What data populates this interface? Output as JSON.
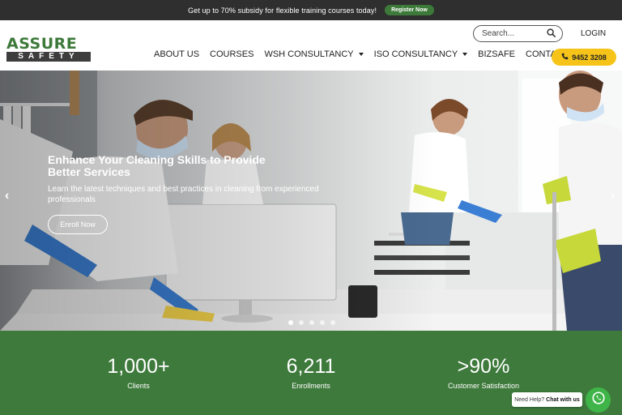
{
  "topbar": {
    "text": "Get up to 70% subsidy for flexible training courses today!",
    "button": "Register Now"
  },
  "logo": {
    "top": "ASSURE",
    "bottom": "SAFETY"
  },
  "search": {
    "placeholder": "Search..."
  },
  "header": {
    "login": "LOGIN",
    "phone": "9452 3208"
  },
  "nav": {
    "items": [
      {
        "label": "ABOUT US"
      },
      {
        "label": "COURSES"
      },
      {
        "label": "WSH CONSULTANCY"
      },
      {
        "label": "ISO CONSULTANCY"
      },
      {
        "label": "BIZSAFE"
      },
      {
        "label": "CONTACT US"
      }
    ]
  },
  "hero": {
    "title": "Enhance Your Cleaning Skills to Provide Better Services",
    "subtitle": "Learn the latest techniques and best practices in cleaning from experienced professionals",
    "button": "Enroll Now",
    "prev": "‹",
    "next": "›"
  },
  "stats": [
    {
      "value": "1,000+",
      "label": "Clients"
    },
    {
      "value": "6,211",
      "label": "Enrollments"
    },
    {
      "value": ">90%",
      "label": "Customer Satisfaction"
    }
  ],
  "help": {
    "prefix": "Need Help?",
    "strong": "Chat with us"
  },
  "colors": {
    "brand_green": "#3e7a3c",
    "accent_yellow": "#f6c419",
    "topbar": "#2f2f2f",
    "whatsapp": "#3fb549"
  },
  "icons": {
    "search": "search-icon",
    "phone": "phone-icon",
    "whatsapp": "whatsapp-icon"
  }
}
